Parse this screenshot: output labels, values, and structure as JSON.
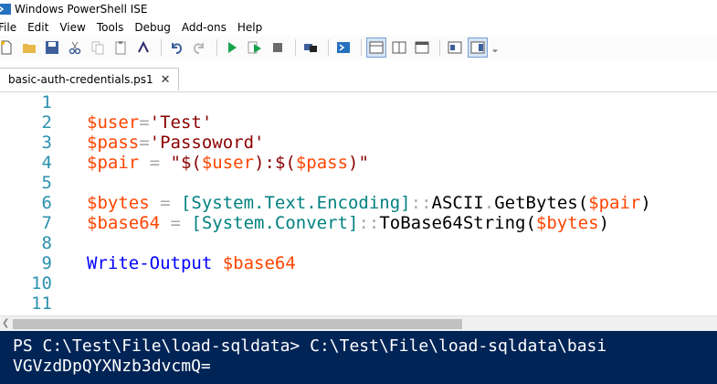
{
  "window": {
    "title": "Windows PowerShell ISE"
  },
  "menu": [
    "File",
    "Edit",
    "View",
    "Tools",
    "Debug",
    "Add-ons",
    "Help"
  ],
  "toolbar": {
    "icons": [
      "new-icon",
      "open-icon",
      "save-icon",
      "cut-icon",
      "copy-icon",
      "paste-icon",
      "console-icon",
      "undo-icon",
      "redo-icon",
      "run-icon",
      "run-selection-icon",
      "stop-icon",
      "remote-icon",
      "powershell-icon",
      "layout-top-icon",
      "layout-right-icon",
      "layout-max-icon",
      "show-commands-icon",
      "addon-pane-icon",
      "overflow-icon"
    ]
  },
  "tab": {
    "label": "basic-auth-credentials.ps1",
    "close": "✕"
  },
  "editor": {
    "lines": [
      {
        "n": "1",
        "tokens": []
      },
      {
        "n": "2",
        "tokens": [
          {
            "t": "$user",
            "c": "var"
          },
          {
            "t": "=",
            "c": "op"
          },
          {
            "t": "'Test'",
            "c": "str"
          }
        ]
      },
      {
        "n": "3",
        "tokens": [
          {
            "t": "$pass",
            "c": "var"
          },
          {
            "t": "=",
            "c": "op"
          },
          {
            "t": "'Passoword'",
            "c": "str"
          }
        ]
      },
      {
        "n": "4",
        "tokens": [
          {
            "t": "$pair",
            "c": "var"
          },
          {
            "t": " = ",
            "c": "op"
          },
          {
            "t": "\"$(",
            "c": "str"
          },
          {
            "t": "$user",
            "c": "var"
          },
          {
            "t": "):$(",
            "c": "str"
          },
          {
            "t": "$pass",
            "c": "var"
          },
          {
            "t": ")\"",
            "c": "str"
          }
        ]
      },
      {
        "n": "5",
        "tokens": []
      },
      {
        "n": "6",
        "tokens": [
          {
            "t": "$bytes",
            "c": "var"
          },
          {
            "t": " = ",
            "c": "op"
          },
          {
            "t": "[System.Text.Encoding]",
            "c": "type"
          },
          {
            "t": "::",
            "c": "op"
          },
          {
            "t": "ASCII",
            "c": "code"
          },
          {
            "t": ".",
            "c": "op"
          },
          {
            "t": "GetBytes(",
            "c": "code"
          },
          {
            "t": "$pair",
            "c": "var"
          },
          {
            "t": ")",
            "c": "code"
          }
        ]
      },
      {
        "n": "7",
        "tokens": [
          {
            "t": "$base64",
            "c": "var"
          },
          {
            "t": " = ",
            "c": "op"
          },
          {
            "t": "[System.Convert]",
            "c": "type"
          },
          {
            "t": "::",
            "c": "op"
          },
          {
            "t": "ToBase64String(",
            "c": "code"
          },
          {
            "t": "$bytes",
            "c": "var"
          },
          {
            "t": ")",
            "c": "code"
          }
        ]
      },
      {
        "n": "8",
        "tokens": []
      },
      {
        "n": "9",
        "tokens": [
          {
            "t": "Write-Output",
            "c": "cmd"
          },
          {
            "t": " ",
            "c": "code"
          },
          {
            "t": "$base64",
            "c": "var"
          }
        ]
      },
      {
        "n": "10",
        "tokens": []
      },
      {
        "n": "11",
        "tokens": []
      }
    ]
  },
  "console": {
    "prompt_line": "PS C:\\Test\\File\\load-sqldata> C:\\Test\\File\\load-sqldata\\basi",
    "output_line": "VGVzdDpQYXNzb3dvcmQ="
  },
  "colors": {
    "console_bg": "#012456",
    "variable": "#ff4500",
    "string": "#8b0000",
    "type": "#008080",
    "command": "#0000ff",
    "line_number": "#2b91af"
  }
}
